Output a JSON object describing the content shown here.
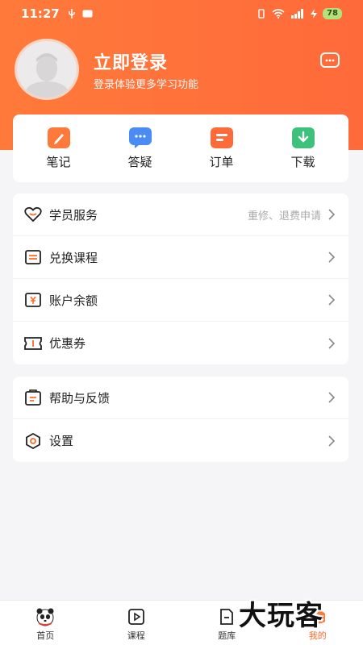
{
  "status": {
    "time": "11:27",
    "battery": "78"
  },
  "profile": {
    "title": "立即登录",
    "subtitle": "登录体验更多学习功能"
  },
  "quick": [
    {
      "label": "笔记",
      "icon": "note-icon",
      "color": "#ff7a3a"
    },
    {
      "label": "答疑",
      "icon": "qa-icon",
      "color": "#4a8bf5"
    },
    {
      "label": "订单",
      "icon": "order-icon",
      "color": "#ff6a3a"
    },
    {
      "label": "下载",
      "icon": "download-icon",
      "color": "#3ec17a"
    }
  ],
  "menu1": [
    {
      "label": "学员服务",
      "extra": "重修、退费申请",
      "icon": "heart-icon"
    },
    {
      "label": "兑换课程",
      "extra": "",
      "icon": "exchange-icon"
    },
    {
      "label": "账户余额",
      "extra": "",
      "icon": "yen-icon"
    },
    {
      "label": "优惠券",
      "extra": "",
      "icon": "coupon-icon"
    }
  ],
  "menu2": [
    {
      "label": "帮助与反馈",
      "icon": "help-icon"
    },
    {
      "label": "设置",
      "icon": "settings-icon"
    }
  ],
  "tabs": [
    {
      "label": "首页",
      "icon": "panda-icon"
    },
    {
      "label": "课程",
      "icon": "play-icon"
    },
    {
      "label": "题库",
      "icon": "document-icon"
    },
    {
      "label": "我的",
      "icon": "me-icon",
      "active": true
    }
  ],
  "watermark": "大玩客"
}
